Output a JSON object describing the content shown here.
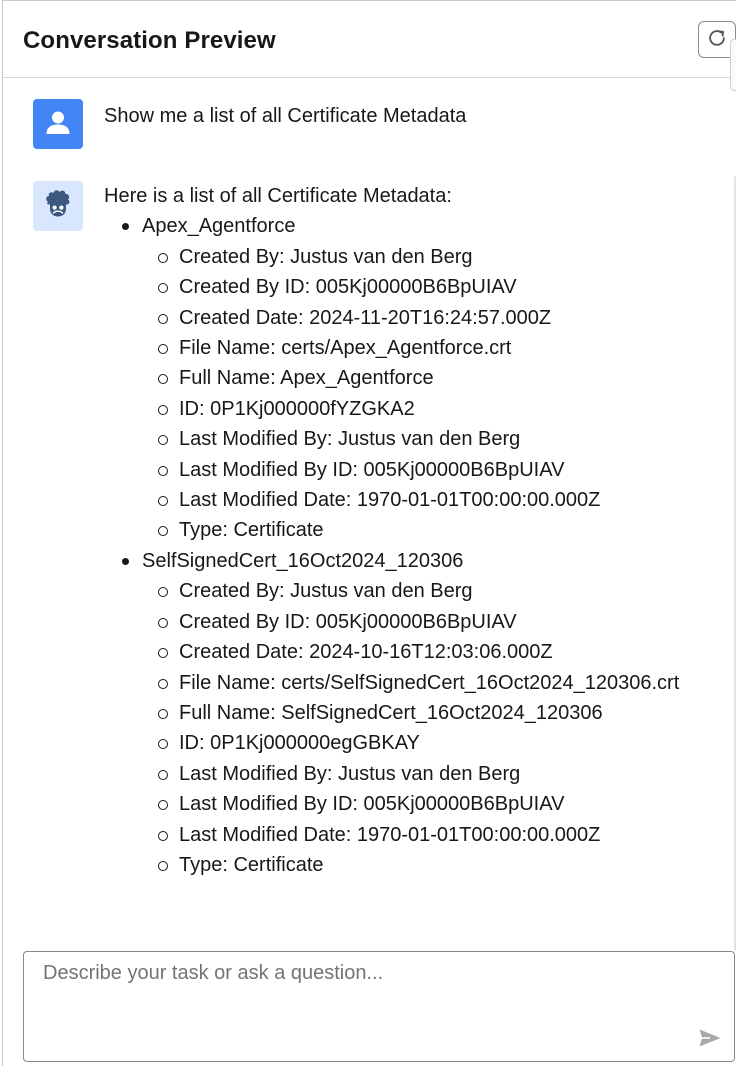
{
  "header": {
    "title": "Conversation Preview",
    "refresh_icon": "refresh-icon"
  },
  "conversation": {
    "user_message": {
      "avatar_icon": "user-icon",
      "text": "Show me a list of all Certificate Metadata"
    },
    "bot_message": {
      "avatar_icon": "einstein-bot-icon",
      "intro": "Here is a list of all Certificate Metadata:",
      "certificates": [
        {
          "name": "Apex_Agentforce",
          "fields": [
            "Created By: Justus van den Berg",
            "Created By ID: 005Kj00000B6BpUIAV",
            "Created Date: 2024-11-20T16:24:57.000Z",
            "File Name: certs/Apex_Agentforce.crt",
            "Full Name: Apex_Agentforce",
            "ID: 0P1Kj000000fYZGKA2",
            "Last Modified By: Justus van den Berg",
            "Last Modified By ID: 005Kj00000B6BpUIAV",
            "Last Modified Date: 1970-01-01T00:00:00.000Z",
            "Type: Certificate"
          ]
        },
        {
          "name": "SelfSignedCert_16Oct2024_120306",
          "fields": [
            "Created By: Justus van den Berg",
            "Created By ID: 005Kj00000B6BpUIAV",
            "Created Date: 2024-10-16T12:03:06.000Z",
            "File Name: certs/SelfSignedCert_16Oct2024_120306.crt",
            "Full Name: SelfSignedCert_16Oct2024_120306",
            "ID: 0P1Kj000000egGBKAY",
            "Last Modified By: Justus van den Berg",
            "Last Modified By ID: 005Kj00000B6BpUIAV",
            "Last Modified Date: 1970-01-01T00:00:00.000Z",
            "Type: Certificate"
          ]
        }
      ]
    }
  },
  "composer": {
    "placeholder": "Describe your task or ask a question...",
    "value": "",
    "send_icon": "send-icon"
  },
  "colors": {
    "user_avatar": "#4285f4",
    "bot_avatar_bg": "#d8e6fe",
    "bot_icon": "#3c5a80",
    "text": "#181818",
    "placeholder": "#747474"
  }
}
